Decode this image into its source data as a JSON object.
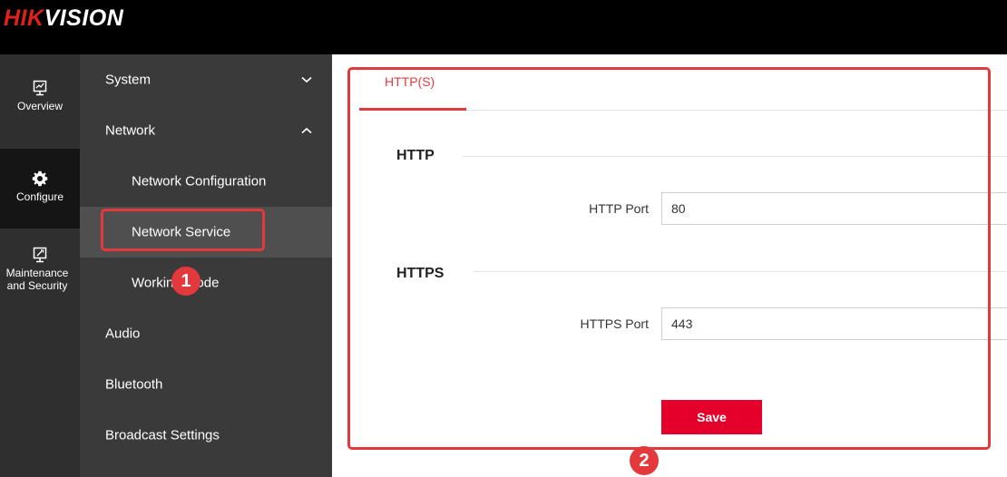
{
  "brand": {
    "part1": "HIK",
    "part2": "VISION",
    "red": "#e0201b"
  },
  "rail": [
    {
      "label1": "Overview",
      "label2": "",
      "icon": "overview-icon"
    },
    {
      "label1": "Configure",
      "label2": "",
      "icon": "gear-icon"
    },
    {
      "label1": "Maintenance",
      "label2": "and Security",
      "icon": "maintenance-icon"
    }
  ],
  "menu": {
    "system": "System",
    "network": "Network",
    "network_configuration": "Network Configuration",
    "network_service": "Network Service",
    "working_mode": "Working Mode",
    "audio": "Audio",
    "bluetooth": "Bluetooth",
    "broadcast_settings": "Broadcast Settings"
  },
  "tabs": {
    "https_tab": "HTTP(S)"
  },
  "http": {
    "title": "HTTP",
    "port_label": "HTTP Port",
    "port_value": "80"
  },
  "https": {
    "title": "HTTPS",
    "port_label": "HTTPS Port",
    "port_value": "443"
  },
  "actions": {
    "save": "Save"
  },
  "annotations": {
    "step1": "1",
    "step2": "2"
  },
  "colors": {
    "accent": "#e4393c",
    "save": "#e4002b",
    "sidebar": "#3a3a3a",
    "rail": "#2f2f2f"
  }
}
